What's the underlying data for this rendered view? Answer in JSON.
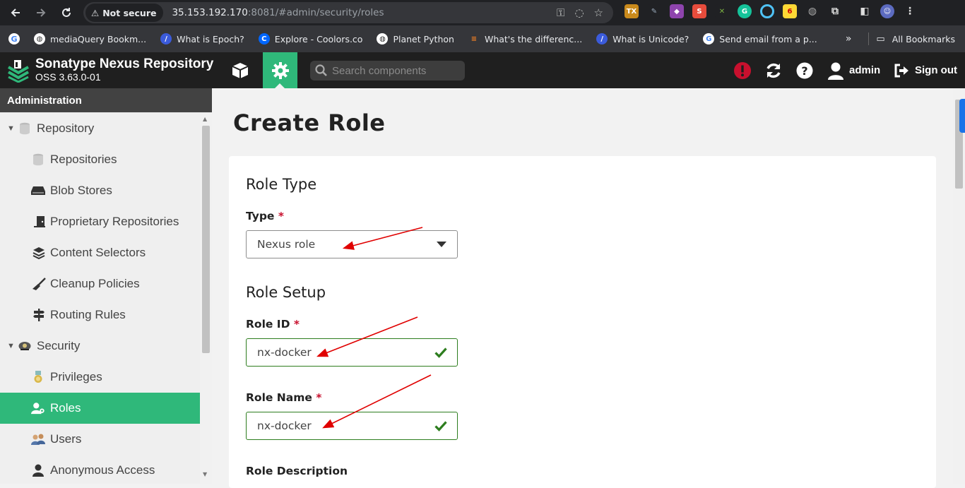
{
  "browser": {
    "security_label": "Not secure",
    "url_host": "35.153.192.170",
    "url_rest": ":8081/#admin/security/roles",
    "bookmarks": [
      {
        "label": "mediaQuery Bookm...",
        "icon": "globe-icon"
      },
      {
        "label": "What is Epoch?",
        "icon": "docs-icon"
      },
      {
        "label": "Explore - Coolors.co",
        "icon": "coolors-icon"
      },
      {
        "label": "Planet Python",
        "icon": "globe-icon"
      },
      {
        "label": "What's the differenc...",
        "icon": "stackoverflow-icon"
      },
      {
        "label": "What is Unicode?",
        "icon": "docs-icon"
      },
      {
        "label": "Send email from a p...",
        "icon": "google-icon"
      }
    ],
    "all_bookmarks_label": "All Bookmarks"
  },
  "app": {
    "brand_title": "Sonatype Nexus Repository",
    "brand_version": "OSS 3.63.0-01",
    "search_placeholder": "Search components",
    "user_label": "admin",
    "signout_label": "Sign out",
    "accent_color": "#2fb87a"
  },
  "sidebar": {
    "title": "Administration",
    "items": [
      {
        "label": "Repository",
        "icon": "database-icon",
        "level": 0,
        "expanded": true
      },
      {
        "label": "Repositories",
        "icon": "database-icon",
        "level": 1
      },
      {
        "label": "Blob Stores",
        "icon": "hdd-icon",
        "level": 1
      },
      {
        "label": "Proprietary Repositories",
        "icon": "door-icon",
        "level": 1
      },
      {
        "label": "Content Selectors",
        "icon": "layers-icon",
        "level": 1
      },
      {
        "label": "Cleanup Policies",
        "icon": "broom-icon",
        "level": 1
      },
      {
        "label": "Routing Rules",
        "icon": "signpost-icon",
        "level": 1
      },
      {
        "label": "Security",
        "icon": "security-icon",
        "level": 0,
        "expanded": true
      },
      {
        "label": "Privileges",
        "icon": "medal-icon",
        "level": 1
      },
      {
        "label": "Roles",
        "icon": "user-role-icon",
        "level": 1,
        "selected": true
      },
      {
        "label": "Users",
        "icon": "users-icon",
        "level": 1
      },
      {
        "label": "Anonymous Access",
        "icon": "user-icon",
        "level": 1
      }
    ]
  },
  "form": {
    "page_title": "Create Role",
    "role_type_heading": "Role Type",
    "type_label": "Type",
    "type_value": "Nexus role",
    "role_setup_heading": "Role Setup",
    "role_id_label": "Role ID",
    "role_id_value": "nx-docker",
    "role_name_label": "Role Name",
    "role_name_value": "nx-docker",
    "role_description_label": "Role Description",
    "required_marker": "*"
  }
}
